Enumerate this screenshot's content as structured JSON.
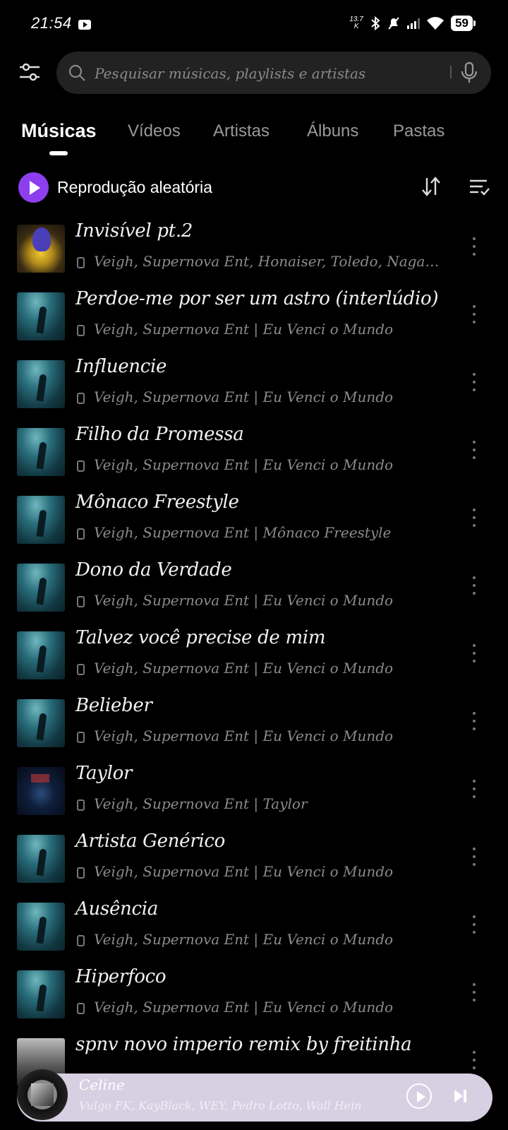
{
  "status_bar": {
    "time": "21:54",
    "net_speed_value": "13.7",
    "net_speed_unit": "K",
    "battery": "59"
  },
  "search": {
    "placeholder": "Pesquisar músicas, playlists e artistas"
  },
  "tabs": [
    "Músicas",
    "Vídeos",
    "Artistas",
    "Álbuns",
    "Pastas"
  ],
  "shuffle": {
    "label": "Reprodução aleatória"
  },
  "songs": [
    {
      "title": "Invisível pt.2",
      "subtitle": "Veigh, Supernova Ent, Honaiser, Toledo, Nagalli, B…",
      "art": "yellow"
    },
    {
      "title": "Perdoe-me por ser um astro (interlúdio)",
      "subtitle": "Veigh, Supernova Ent | Eu Venci o Mundo",
      "art": "teal"
    },
    {
      "title": "Influencie",
      "subtitle": "Veigh, Supernova Ent | Eu Venci o Mundo",
      "art": "teal"
    },
    {
      "title": "Filho da Promessa",
      "subtitle": "Veigh, Supernova Ent | Eu Venci o Mundo",
      "art": "teal"
    },
    {
      "title": "Mônaco Freestyle",
      "subtitle": "Veigh, Supernova Ent | Mônaco Freestyle",
      "art": "teal"
    },
    {
      "title": "Dono da Verdade",
      "subtitle": "Veigh, Supernova Ent | Eu Venci o Mundo",
      "art": "teal"
    },
    {
      "title": "Talvez você precise de mim",
      "subtitle": "Veigh, Supernova Ent | Eu Venci o Mundo",
      "art": "teal"
    },
    {
      "title": "Belieber",
      "subtitle": "Veigh, Supernova Ent | Eu Venci o Mundo",
      "art": "teal"
    },
    {
      "title": "Taylor",
      "subtitle": "Veigh, Supernova Ent | Taylor",
      "art": "dark"
    },
    {
      "title": "Artista Genérico",
      "subtitle": "Veigh, Supernova Ent | Eu Venci o Mundo",
      "art": "teal"
    },
    {
      "title": "Ausência",
      "subtitle": "Veigh, Supernova Ent | Eu Venci o Mundo",
      "art": "teal"
    },
    {
      "title": "Hiperfoco",
      "subtitle": "Veigh, Supernova Ent | Eu Venci o Mundo",
      "art": "teal"
    },
    {
      "title": "spnv   novo imperio remix by freitinha",
      "subtitle": "",
      "art": "bw"
    }
  ],
  "now_playing": {
    "title": "Celine",
    "artists": "Vulgo FK, KayBlack, WEY, Pedro Lotto, Wall Hein"
  },
  "colors": {
    "accent": "#8d3ff0",
    "background": "#000000",
    "search_bg": "#222222",
    "mini_player_bg": "#d6d0e2"
  }
}
